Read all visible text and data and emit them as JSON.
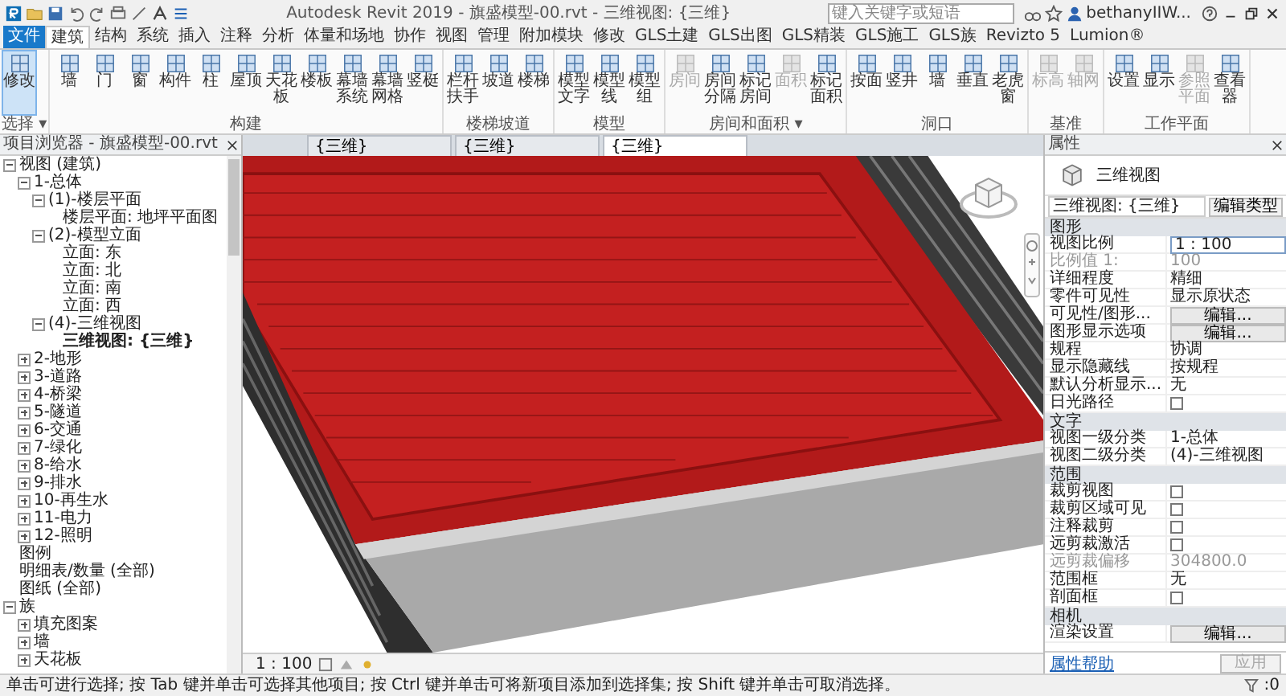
{
  "window": {
    "title": "Autodesk Revit 2019 -  旗盛模型-00.rvt - 三维视图: {三维}",
    "search": {
      "placeholder": "键入关键字或短语"
    },
    "user": "bethanyIIW..."
  },
  "ribbon_tabs": [
    {
      "label": "文件",
      "kind": "app",
      "selected": false
    },
    {
      "label": "建筑",
      "kind": "tab",
      "selected": true
    },
    {
      "label": "结构",
      "kind": "tab",
      "selected": false
    },
    {
      "label": "系统",
      "kind": "tab",
      "selected": false
    },
    {
      "label": "插入",
      "kind": "tab",
      "selected": false
    },
    {
      "label": "注释",
      "kind": "tab",
      "selected": false
    },
    {
      "label": "分析",
      "kind": "tab",
      "selected": false
    },
    {
      "label": "体量和场地",
      "kind": "tab",
      "selected": false
    },
    {
      "label": "协作",
      "kind": "tab",
      "selected": false
    },
    {
      "label": "视图",
      "kind": "tab",
      "selected": false
    },
    {
      "label": "管理",
      "kind": "tab",
      "selected": false
    },
    {
      "label": "附加模块",
      "kind": "tab",
      "selected": false
    },
    {
      "label": "修改",
      "kind": "tab",
      "selected": false
    },
    {
      "label": "GLS土建",
      "kind": "tab",
      "selected": false
    },
    {
      "label": "GLS出图",
      "kind": "tab",
      "selected": false
    },
    {
      "label": "GLS精装",
      "kind": "tab",
      "selected": false
    },
    {
      "label": "GLS施工",
      "kind": "tab",
      "selected": false
    },
    {
      "label": "GLS族",
      "kind": "tab",
      "selected": false
    },
    {
      "label": "Revizto 5",
      "kind": "tab",
      "selected": false
    },
    {
      "label": "Lumion®",
      "kind": "tab",
      "selected": false
    }
  ],
  "ribbon_panels": [
    {
      "label": "选择 ▾",
      "buttons": [
        {
          "label": "修改",
          "selected": true,
          "disabled": false
        }
      ]
    },
    {
      "label": "构建",
      "buttons": [
        {
          "label": "墙",
          "selected": false,
          "disabled": false
        },
        {
          "label": "门",
          "selected": false,
          "disabled": false
        },
        {
          "label": "窗",
          "selected": false,
          "disabled": false
        },
        {
          "label": "构件",
          "selected": false,
          "disabled": false
        },
        {
          "label": "柱",
          "selected": false,
          "disabled": false
        },
        {
          "label": "屋顶",
          "selected": false,
          "disabled": false
        },
        {
          "label": "天花板",
          "selected": false,
          "disabled": false
        },
        {
          "label": "楼板",
          "selected": false,
          "disabled": false
        },
        {
          "label": "幕墙系统",
          "selected": false,
          "disabled": false
        },
        {
          "label": "幕墙网格",
          "selected": false,
          "disabled": false
        },
        {
          "label": "竖梃",
          "selected": false,
          "disabled": false
        }
      ]
    },
    {
      "label": "楼梯坡道",
      "buttons": [
        {
          "label": "栏杆扶手",
          "selected": false,
          "disabled": false
        },
        {
          "label": "坡道",
          "selected": false,
          "disabled": false
        },
        {
          "label": "楼梯",
          "selected": false,
          "disabled": false
        }
      ]
    },
    {
      "label": "模型",
      "buttons": [
        {
          "label": "模型文字",
          "selected": false,
          "disabled": false
        },
        {
          "label": "模型线",
          "selected": false,
          "disabled": false
        },
        {
          "label": "模型组",
          "selected": false,
          "disabled": false
        }
      ]
    },
    {
      "label": "房间和面积 ▾",
      "buttons": [
        {
          "label": "房间",
          "selected": false,
          "disabled": true
        },
        {
          "label": "房间分隔",
          "selected": false,
          "disabled": false
        },
        {
          "label": "标记房间",
          "selected": false,
          "disabled": false
        },
        {
          "label": "面积",
          "selected": false,
          "disabled": true
        },
        {
          "label": "标记面积",
          "selected": false,
          "disabled": false
        }
      ]
    },
    {
      "label": "洞口",
      "buttons": [
        {
          "label": "按面",
          "selected": false,
          "disabled": false
        },
        {
          "label": "竖井",
          "selected": false,
          "disabled": false
        },
        {
          "label": "墙",
          "selected": false,
          "disabled": false
        },
        {
          "label": "垂直",
          "selected": false,
          "disabled": false
        },
        {
          "label": "老虎窗",
          "selected": false,
          "disabled": false
        }
      ]
    },
    {
      "label": "基准",
      "buttons": [
        {
          "label": "标高",
          "selected": false,
          "disabled": true
        },
        {
          "label": "轴网",
          "selected": false,
          "disabled": true
        }
      ]
    },
    {
      "label": "工作平面",
      "buttons": [
        {
          "label": "设置",
          "selected": false,
          "disabled": false
        },
        {
          "label": "显示",
          "selected": false,
          "disabled": false
        },
        {
          "label": "参照平面",
          "selected": false,
          "disabled": true
        },
        {
          "label": "查看器",
          "selected": false,
          "disabled": false
        }
      ]
    }
  ],
  "browser": {
    "title": "项目浏览器 - 旗盛模型-00.rvt",
    "tree": [
      {
        "label": "视图 (建筑)",
        "expanded": true,
        "selected": false,
        "children": [
          {
            "label": "1-总体",
            "expanded": true,
            "selected": false,
            "children": [
              {
                "label": "(1)-楼层平面",
                "expanded": true,
                "selected": false,
                "children": [
                  {
                    "label": "楼层平面: 地坪平面图",
                    "selected": false
                  }
                ]
              },
              {
                "label": "(2)-模型立面",
                "expanded": true,
                "selected": false,
                "children": [
                  {
                    "label": "立面: 东",
                    "selected": false
                  },
                  {
                    "label": "立面: 北",
                    "selected": false
                  },
                  {
                    "label": "立面: 南",
                    "selected": false
                  },
                  {
                    "label": "立面: 西",
                    "selected": false
                  }
                ]
              },
              {
                "label": "(4)-三维视图",
                "expanded": true,
                "selected": false,
                "children": [
                  {
                    "label": "三维视图: {三维}",
                    "selected": true
                  }
                ]
              }
            ]
          },
          {
            "label": "2-地形",
            "expanded": false,
            "selected": false
          },
          {
            "label": "3-道路",
            "expanded": false,
            "selected": false
          },
          {
            "label": "4-桥梁",
            "expanded": false,
            "selected": false
          },
          {
            "label": "5-隧道",
            "expanded": false,
            "selected": false
          },
          {
            "label": "6-交通",
            "expanded": false,
            "selected": false
          },
          {
            "label": "7-绿化",
            "expanded": false,
            "selected": false
          },
          {
            "label": "8-给水",
            "expanded": false,
            "selected": false
          },
          {
            "label": "9-排水",
            "expanded": false,
            "selected": false
          },
          {
            "label": "10-再生水",
            "expanded": false,
            "selected": false
          },
          {
            "label": "11-电力",
            "expanded": false,
            "selected": false
          },
          {
            "label": "12-照明",
            "expanded": false,
            "selected": false
          }
        ]
      },
      {
        "label": "图例",
        "selected": false
      },
      {
        "label": "明细表/数量 (全部)",
        "selected": false
      },
      {
        "label": "图纸 (全部)",
        "selected": false
      },
      {
        "label": "族",
        "expanded": true,
        "selected": false,
        "children": [
          {
            "label": "填充图案",
            "expanded": false,
            "selected": false
          },
          {
            "label": "墙",
            "expanded": false,
            "selected": false
          },
          {
            "label": "天花板",
            "expanded": false,
            "selected": false
          }
        ]
      }
    ]
  },
  "view_tabs": [
    {
      "label": "{三维}",
      "selected": false
    },
    {
      "label": "{三维}",
      "selected": false
    },
    {
      "label": "{三维}",
      "selected": true
    }
  ],
  "view_control": {
    "scale": "1 : 100"
  },
  "properties": {
    "title": "属性",
    "type_name": "三维视图",
    "selector": "三维视图: {三维}",
    "edit_type": "编辑类型",
    "rows": [
      {
        "kind": "group",
        "label": "图形"
      },
      {
        "kind": "field",
        "label": "视图比例",
        "value": "1 : 100",
        "disabled": false
      },
      {
        "kind": "text",
        "label": "比例值 1:",
        "value": "100",
        "disabled": true
      },
      {
        "kind": "text",
        "label": "详细程度",
        "value": "精细",
        "disabled": false
      },
      {
        "kind": "text",
        "label": "零件可见性",
        "value": "显示原状态",
        "disabled": false
      },
      {
        "kind": "button",
        "label": "可见性/图形...",
        "value": "编辑...",
        "disabled": false
      },
      {
        "kind": "button",
        "label": "图形显示选项",
        "value": "编辑...",
        "disabled": false
      },
      {
        "kind": "text",
        "label": "规程",
        "value": "协调",
        "disabled": false
      },
      {
        "kind": "text",
        "label": "显示隐藏线",
        "value": "按规程",
        "disabled": false
      },
      {
        "kind": "text",
        "label": "默认分析显示...",
        "value": "无",
        "disabled": false
      },
      {
        "kind": "checkbox",
        "label": "日光路径",
        "checked": false,
        "disabled": false
      },
      {
        "kind": "group",
        "label": "文字"
      },
      {
        "kind": "text",
        "label": "视图一级分类",
        "value": "1-总体",
        "disabled": false
      },
      {
        "kind": "text",
        "label": "视图二级分类",
        "value": "(4)-三维视图",
        "disabled": false
      },
      {
        "kind": "group",
        "label": "范围"
      },
      {
        "kind": "checkbox",
        "label": "裁剪视图",
        "checked": false,
        "disabled": false
      },
      {
        "kind": "checkbox",
        "label": "裁剪区域可见",
        "checked": false,
        "disabled": false
      },
      {
        "kind": "checkbox",
        "label": "注释裁剪",
        "checked": false,
        "disabled": false
      },
      {
        "kind": "checkbox",
        "label": "远剪裁激活",
        "checked": false,
        "disabled": false
      },
      {
        "kind": "text",
        "label": "远剪裁偏移",
        "value": "304800.0",
        "disabled": true
      },
      {
        "kind": "text",
        "label": "范围框",
        "value": "无",
        "disabled": false
      },
      {
        "kind": "checkbox",
        "label": "剖面框",
        "checked": false,
        "disabled": false
      },
      {
        "kind": "group",
        "label": "相机"
      },
      {
        "kind": "button",
        "label": "渲染设置",
        "value": "编辑...",
        "disabled": false
      }
    ],
    "help_link": "属性帮助",
    "apply": {
      "label": "应用",
      "disabled": true
    }
  },
  "status_bar": {
    "message": "单击可进行选择; 按 Tab 键并单击可选择其他项目; 按 Ctrl 键并单击可将新项目添加到选择集; 按 Shift 键并单击可取消选择。",
    "count": ":0"
  }
}
